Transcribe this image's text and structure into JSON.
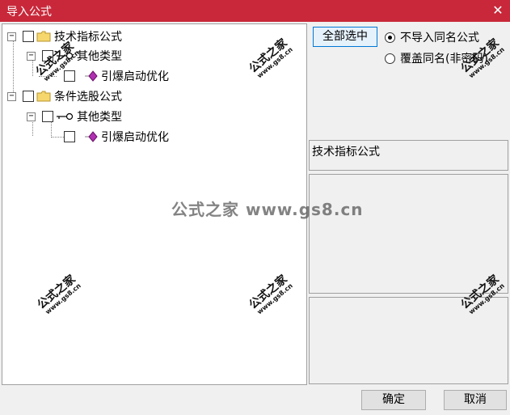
{
  "window": {
    "title": "导入公式",
    "close_glyph": "✕"
  },
  "tree": {
    "nodes": [
      {
        "label": "技术指标公式",
        "expander": "−",
        "icon": "folder-icon"
      },
      {
        "label": "其他类型",
        "expander": "−",
        "icon": "key-icon"
      },
      {
        "label": "引爆启动优化",
        "expander": "",
        "icon": "diamond-icon"
      },
      {
        "label": "条件选股公式",
        "expander": "−",
        "icon": "folder-icon"
      },
      {
        "label": "其他类型",
        "expander": "−",
        "icon": "key-icon"
      },
      {
        "label": "引爆启动优化",
        "expander": "",
        "icon": "diamond-icon"
      }
    ]
  },
  "options": {
    "select_all_label": "全部选中",
    "radio_skip_label": "不导入同名公式",
    "radio_overwrite_label": "覆盖同名(非密码)",
    "radio_selected": "skip"
  },
  "info": {
    "formula_type": "技术指标公式"
  },
  "watermark": {
    "center": "公式之家 www.gs8.cn",
    "stamp_cn": "公式之家",
    "stamp_url": "www.gs8.cn"
  },
  "buttons": {
    "ok_label": "确定",
    "cancel_label": "取消"
  },
  "colors": {
    "titlebar": "#c8283a",
    "folder": "#f5d76e",
    "diamond": "#b030b0"
  }
}
